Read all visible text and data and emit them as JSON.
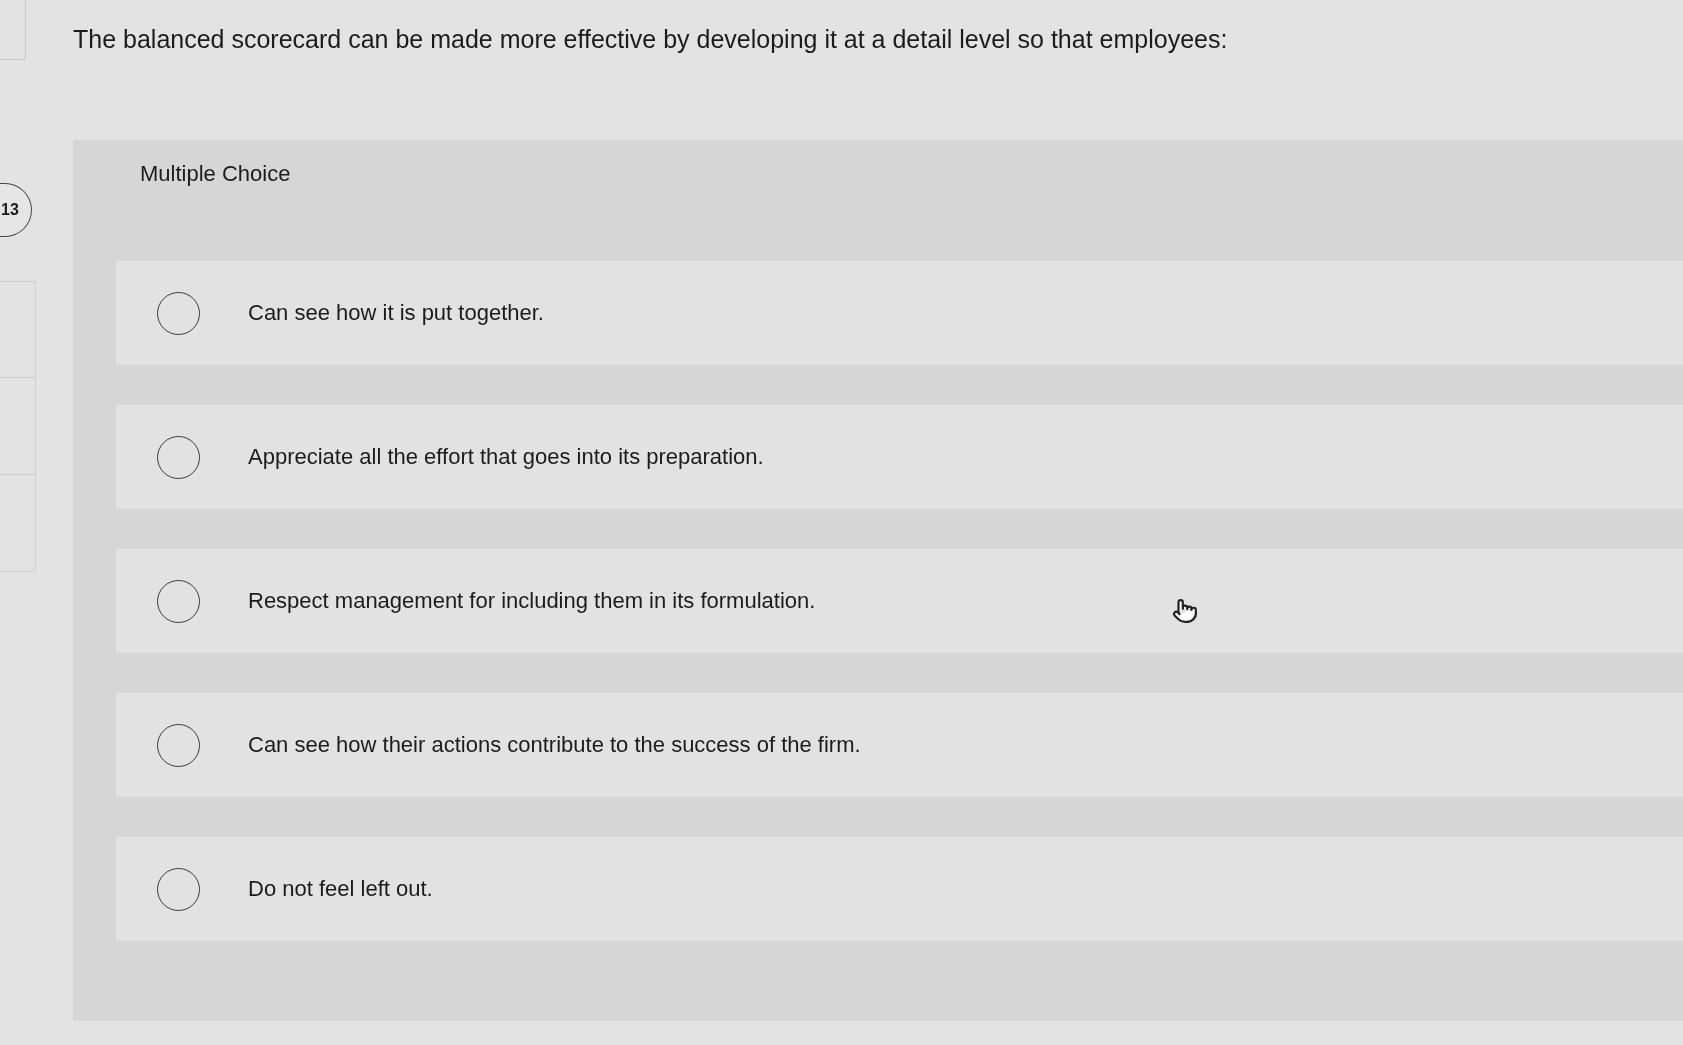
{
  "question_number": "13",
  "question": {
    "text": "The balanced scorecard can be made more effective by developing it at a detail level so that employees:"
  },
  "answer_panel": {
    "type_label": "Multiple Choice",
    "options": [
      {
        "label": "Can see how it is put together.",
        "selected": false
      },
      {
        "label": "Appreciate all the effort that goes into its preparation.",
        "selected": false
      },
      {
        "label": "Respect management for including them in its formulation.",
        "selected": false
      },
      {
        "label": "Can see how their actions contribute to the success of the firm.",
        "selected": false
      },
      {
        "label": "Do not feel left out.",
        "selected": false
      }
    ]
  }
}
